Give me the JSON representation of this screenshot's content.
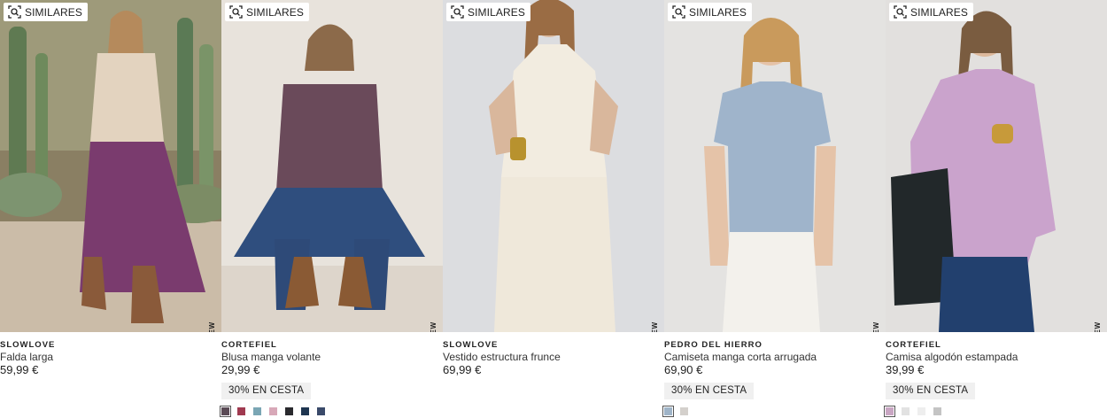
{
  "similar_label": "SIMILARES",
  "products": [
    {
      "brand": "SLOWLOVE",
      "name": "Falda larga",
      "price": "59,99 €",
      "new_tag": "NEW",
      "promo": "",
      "swatches": []
    },
    {
      "brand": "CORTEFIEL",
      "name": "Blusa manga volante",
      "price": "29,99 €",
      "new_tag": "NEW",
      "promo": "30% EN CESTA",
      "swatches": [
        "#5a4a55",
        "#a03a50",
        "#7aa6b4",
        "#d8a8b8",
        "#2a2a2e",
        "#1e3550",
        "#3a4a6a"
      ]
    },
    {
      "brand": "SLOWLOVE",
      "name": "Vestido estructura frunce",
      "price": "69,99 €",
      "new_tag": "NEW",
      "promo": "",
      "swatches": []
    },
    {
      "brand": "PEDRO DEL HIERRO",
      "name": "Camiseta manga corta arrugada",
      "price": "69,90 €",
      "new_tag": "NEW",
      "promo": "30% EN CESTA",
      "swatches": [
        "#9fb4c8",
        "#d4d0cc"
      ]
    },
    {
      "brand": "CORTEFIEL",
      "name": "Camisa algodón estampada",
      "price": "39,99 €",
      "new_tag": "NEW",
      "promo": "30% EN CESTA",
      "swatches": [
        "#c9a6c3",
        "#e2e2e2",
        "#eeeeee",
        "#c4c4c4"
      ]
    }
  ]
}
